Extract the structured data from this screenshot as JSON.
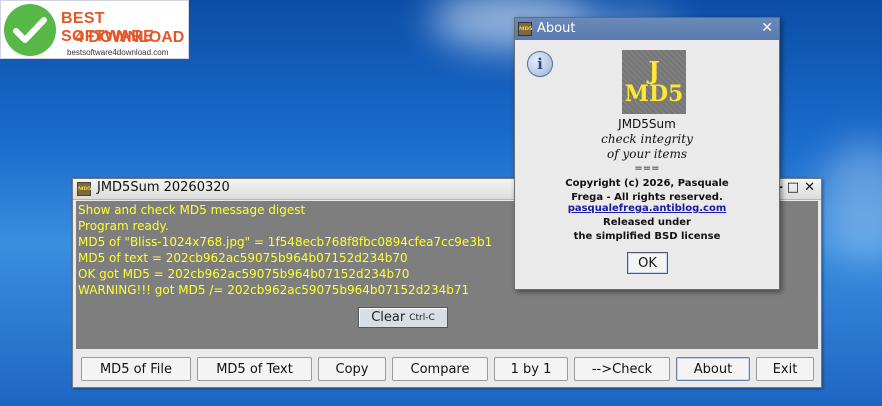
{
  "logo": {
    "line1": "BEST SOFTWARE",
    "line2": "4 DOWNLOAD",
    "url": "bestsoftware4download.com"
  },
  "main_window": {
    "title": "JMD5Sum 20260320",
    "icon_text": "MD5",
    "controls": {
      "minimize": "–",
      "maximize": "□",
      "close": "✕"
    },
    "log_lines": [
      "Show and check MD5 message digest",
      "Program ready.",
      "MD5 of \"Bliss-1024x768.jpg\" = 1f548ecb768f8fbc0894cfea7cc9e3b1",
      "MD5 of text = 202cb962ac59075b964b07152d234b70",
      "OK got MD5 = 202cb962ac59075b964b07152d234b70",
      "WARNING!!! got MD5 /= 202cb962ac59075b964b07152d234b71"
    ],
    "clear_button": {
      "label": "Clear",
      "shortcut": "Ctrl-C"
    },
    "buttons": [
      "MD5 of File",
      "MD5 of Text",
      "Copy",
      "Compare",
      "1 by 1",
      "-->Check",
      "About",
      "Exit"
    ]
  },
  "about_dialog": {
    "title": "About",
    "icon_text": "MD5",
    "info_icon_glyph": "i",
    "logo_j": "J",
    "logo_md5": "MD5",
    "app_name": "JMD5Sum",
    "tagline_1": "check integrity",
    "tagline_2": "of your items",
    "separator": "===",
    "copyright_1": "Copyright (c) 2026, Pasquale",
    "copyright_2": "Frega - All rights reserved.",
    "link": "pasqualefrega.antiblog.com",
    "license_1": "Released under",
    "license_2": "the simplified BSD license",
    "ok_label": "OK"
  }
}
